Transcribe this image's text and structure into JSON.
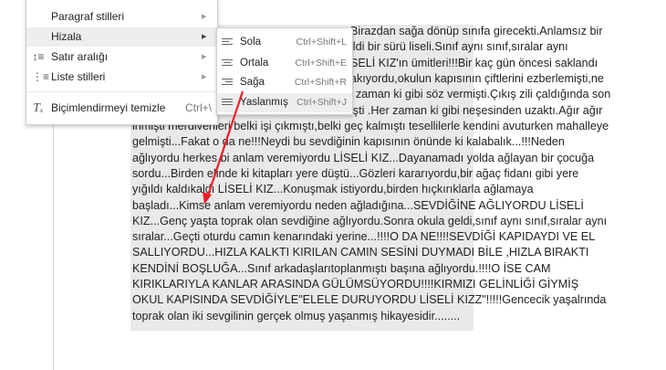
{
  "document": {
    "visible_fragments": [
      "Birazdan sağa dönüp sınıfa girecekti.Anlamsız bir",
      "ildi bir sürü liseli.Sınıf aynı sınıf,sıralar aynı",
      "SELİ KIZ'ın ümitleri!!!Bir kaç gün öncesi saklandı",
      "akıyordu,okulun kapısının çiftlerini ezberlemişti,ne",
      "zaman ki gibi söz vermişti.Çıkış zili çaldığında son",
      "işti .Her zaman ki gibi neşesinden uzaktı.Ağır ağır"
    ],
    "lines": [
      "inmişti merdivenleri belki işi çıkmıştı,belki geç kalmıştı tesellilerle kendini avuturken mahalleye",
      "gelmişti...Fakat o da ne!!!Neydi bu sevdiğinin kapısının önünde ki kalabalık...!!!Neden",
      "ağlıyordu herkes bi anlam veremiyordu LİSELİ KIZ...Dayanamadı yolda ağlayan bir çocuğa",
      "sordu...Birden elinde ki kitapları yere düştü...Gözleri kararıyordu,bir ağaç fidanı gibi yere",
      "yığıldı kaldıkaldı LİSELİ KIZ...Konuşmak istiyordu,birden hıçkırıklarla ağlamaya",
      "başladı...Kimse anlam veremiyordu neden ağladığına...SEVDİĞİNE AĞLIYORDU LİSELİ",
      "KIZ...Genç yaşta toprak olan sevdiğine ağlıyordu.Sonra okula geldi,sınıf aynı sınıf,sıralar aynı",
      "sıralar...Geçti oturdu camın kenarındaki yerine...!!!!O DA NE!!!!SEVDİĞİ KAPIDAYDI VE EL",
      "SALLIYORDU...HIZLA KALKTI KIRILAN CAMIN SESİNİ DUYMADI BİLE ,HIZLA BIRAKTI",
      "KENDİNİ BOŞLUĞA...Sınıf arkadaşlarıtoplanmıştı başına ağlıyordu.!!!!O İSE CAM",
      "KIRIKLARIYLA KANLAR ARASINDA GÜLÜMSÜYORDU!!!!KIRMIZI GELİNLİĞİ GİYMİŞ",
      "OKUL KAPISINDA SEVDİĞİYLE\"ELELE DURUYORDU LİSELİ KIZZ\"!!!!!Gencecik yaşalrında",
      "toprak olan iki sevgilinin gerçek olmuş yaşanmış hikayesidir........"
    ]
  },
  "format_menu": {
    "items": [
      {
        "label": "Paragraf stilleri",
        "icon": "none",
        "has_submenu": true
      },
      {
        "label": "Hizala",
        "icon": "none",
        "has_submenu": true,
        "highlighted": true
      },
      {
        "label": "Satır aralığı",
        "icon": "line-spacing-icon",
        "has_submenu": true
      },
      {
        "label": "Liste stilleri",
        "icon": "list-icon",
        "has_submenu": true
      },
      {
        "label": "Biçimlendirmeyi temizle",
        "icon": "clear-formatting-icon",
        "shortcut": "Ctrl+\\"
      }
    ]
  },
  "align_submenu": {
    "items": [
      {
        "label": "Sola",
        "shortcut": "Ctrl+Shift+L",
        "icon": "align-left-icon"
      },
      {
        "label": "Ortala",
        "shortcut": "Ctrl+Shift+E",
        "icon": "align-center-icon"
      },
      {
        "label": "Sağa",
        "shortcut": "Ctrl+Shift+R",
        "icon": "align-right-icon"
      },
      {
        "label": "Yaslanmış",
        "shortcut": "Ctrl+Shift+J",
        "icon": "align-justify-icon",
        "highlighted": true
      }
    ]
  },
  "annotation": {
    "color": "#e8202a",
    "shape": "arrow"
  }
}
